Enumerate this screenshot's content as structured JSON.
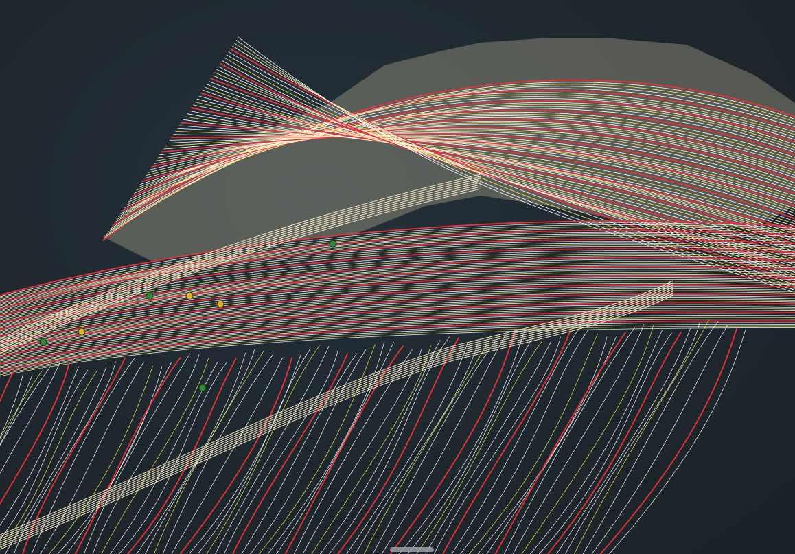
{
  "viewport": {
    "background_color": "#1f272e",
    "contour_colors": {
      "minor": "#ffffff",
      "intermediate": "#f0f05a",
      "major": "#e8333a"
    },
    "surface_fill_color": "#eadfb8",
    "markers": [
      {
        "color": "#2e8b3a",
        "kind": "green-point"
      },
      {
        "color": "#2e8b3a",
        "kind": "green-point"
      },
      {
        "color": "#2e8b3a",
        "kind": "green-point"
      },
      {
        "color": "#2e8b3a",
        "kind": "green-point"
      },
      {
        "color": "#e0b020",
        "kind": "yellow-point"
      },
      {
        "color": "#e0b020",
        "kind": "yellow-point"
      },
      {
        "color": "#e0b020",
        "kind": "yellow-point"
      }
    ]
  },
  "scrollbar": {
    "icon": "horizontal-scroll-handle"
  }
}
